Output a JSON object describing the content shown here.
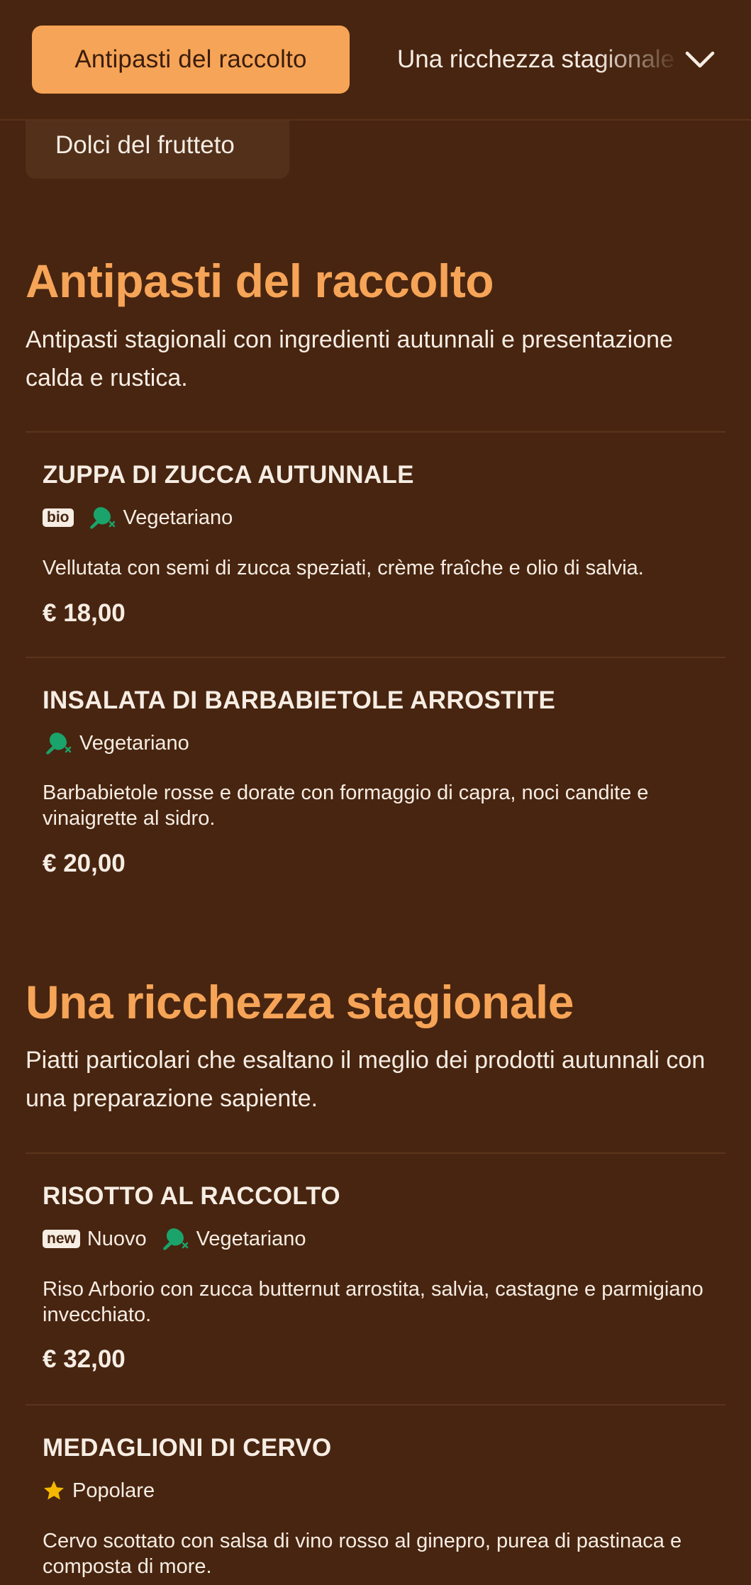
{
  "nav": {
    "active_tab": "Antipasti del raccolto",
    "next_tab": "Una ricchezza stagionale",
    "hidden_tab": "Dolci del frutteto",
    "expand_icon": "chevron-down-icon"
  },
  "colors": {
    "background": "#482510",
    "accent": "#f6a457",
    "text": "#f6ede4",
    "veg_icon": "#1aa36a",
    "star": "#f5b800"
  },
  "sections": [
    {
      "title": "Antipasti del raccolto",
      "description": "Antipasti stagionali con ingredienti autunnali e presentazione calda e rustica.",
      "items": [
        {
          "name": "ZUPPA DI ZUCCA AUTUNNALE",
          "badge": "bio",
          "tag": "Vegetariano",
          "description": "Vellutata con semi di zucca speziati, crème fraîche e olio di salvia.",
          "price": "€ 18,00"
        },
        {
          "name": "INSALATA DI BARBABIETOLE ARROSTITE",
          "tag": "Vegetariano",
          "description": "Barbabietole rosse e dorate con formaggio di capra, noci candite e vinaigrette al sidro.",
          "price": "€ 20,00"
        }
      ]
    },
    {
      "title": "Una ricchezza stagionale",
      "description": "Piatti particolari che esaltano il meglio dei prodotti autunnali con una preparazione sapiente.",
      "items": [
        {
          "name": "RISOTTO AL RACCOLTO",
          "badge": "new",
          "badge_label": "Nuovo",
          "tag": "Vegetariano",
          "description": "Riso Arborio con zucca butternut arrostita, salvia, castagne e parmigiano invecchiato.",
          "price": "€ 32,00"
        },
        {
          "name": "MEDAGLIONI DI CERVO",
          "tag": "Popolare",
          "description": "Cervo scottato con salsa di vino rosso al ginepro, purea di pastinaca e composta di more."
        }
      ]
    }
  ]
}
